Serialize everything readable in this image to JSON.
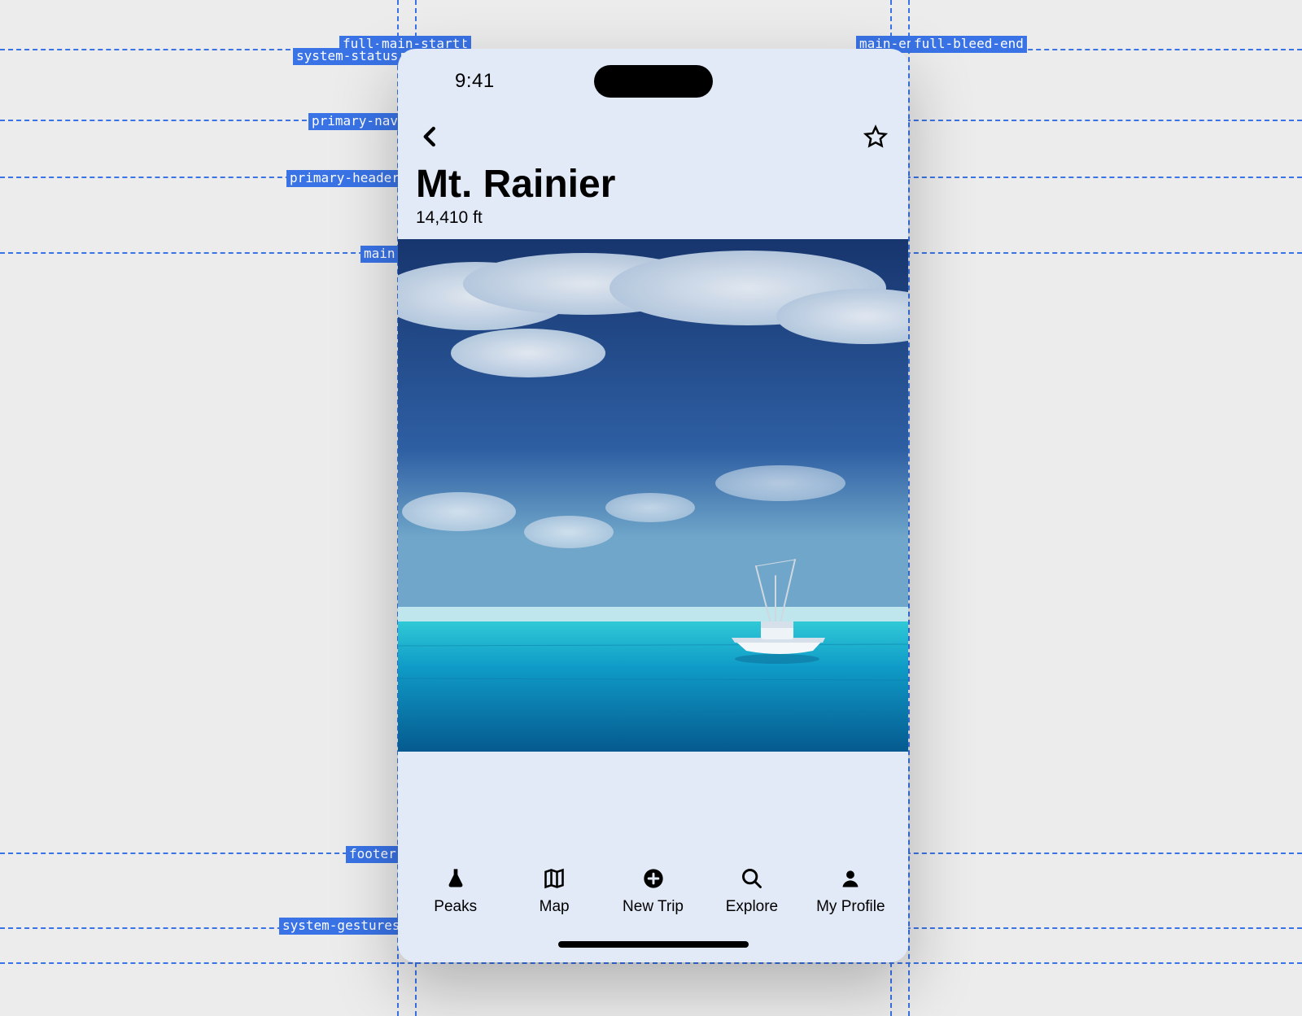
{
  "status": {
    "time": "9:41"
  },
  "header": {
    "title": "Mt. Rainier",
    "subtitle": "14,410 ft"
  },
  "tabs": [
    {
      "label": "Peaks"
    },
    {
      "label": "Map"
    },
    {
      "label": "New Trip"
    },
    {
      "label": "Explore"
    },
    {
      "label": "My Profile"
    }
  ],
  "guides": {
    "full_bleed_start": "full-bleed-start",
    "main_start": "main-start",
    "main_end": "main-end",
    "full_bleed_end": "full-bleed-end",
    "system_status": "system-status",
    "primary_nav": "primary-nav",
    "primary_header": "primary-header",
    "main": "main",
    "footer": "footer",
    "system_gestures": "system-gestures"
  }
}
